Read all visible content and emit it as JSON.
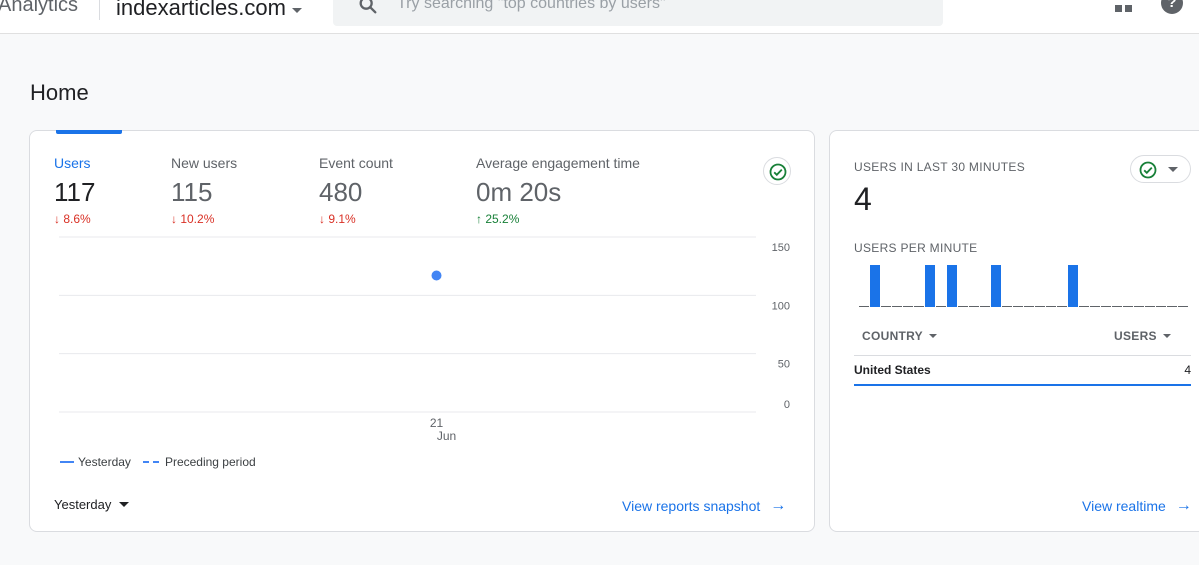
{
  "header": {
    "brand": "Analytics",
    "property": "indexarticles.com",
    "search_placeholder": "Try searching \"top countries by users\"",
    "help_glyph": "?"
  },
  "page": {
    "title": "Home"
  },
  "overview": {
    "metrics": [
      {
        "label": "Users",
        "value": "117",
        "change": "↓ 8.6%",
        "direction": "down",
        "active": true
      },
      {
        "label": "New users",
        "value": "115",
        "change": "↓ 10.2%",
        "direction": "down",
        "active": false
      },
      {
        "label": "Event count",
        "value": "480",
        "change": "↓ 9.1%",
        "direction": "down",
        "active": false
      },
      {
        "label": "Average engagement time",
        "value": "0m 20s",
        "change": "↑ 25.2%",
        "direction": "up",
        "active": false
      }
    ],
    "legend": {
      "current": "Yesterday",
      "previous": "Preceding period"
    },
    "date_range": "Yesterday",
    "view_link": "View reports snapshot",
    "colors": {
      "accent": "#1a73e8",
      "down": "#d93025",
      "up": "#188038",
      "series": "#4285f4"
    }
  },
  "chart_data": {
    "type": "line",
    "x": [
      "21 Jun"
    ],
    "x_tick_labels": [
      {
        "day": "21",
        "month": "Jun"
      }
    ],
    "yticks": [
      150,
      100,
      50,
      0
    ],
    "ylim": [
      0,
      150
    ],
    "series": [
      {
        "name": "Yesterday",
        "values": [
          117
        ]
      }
    ],
    "grid": true
  },
  "realtime": {
    "title": "USERS IN LAST 30 MINUTES",
    "value": "4",
    "per_minute_label": "USERS PER MINUTE",
    "per_minute": [
      0,
      1,
      0,
      0,
      0,
      0,
      1,
      0,
      1,
      0,
      0,
      0,
      1,
      0,
      0,
      0,
      0,
      0,
      0,
      1,
      0,
      0,
      0,
      0,
      0,
      0,
      0,
      0,
      0,
      0
    ],
    "table": {
      "col_country": "COUNTRY",
      "col_users": "USERS",
      "rows": [
        {
          "country": "United States",
          "users": "4"
        }
      ]
    },
    "view_link": "View realtime"
  }
}
